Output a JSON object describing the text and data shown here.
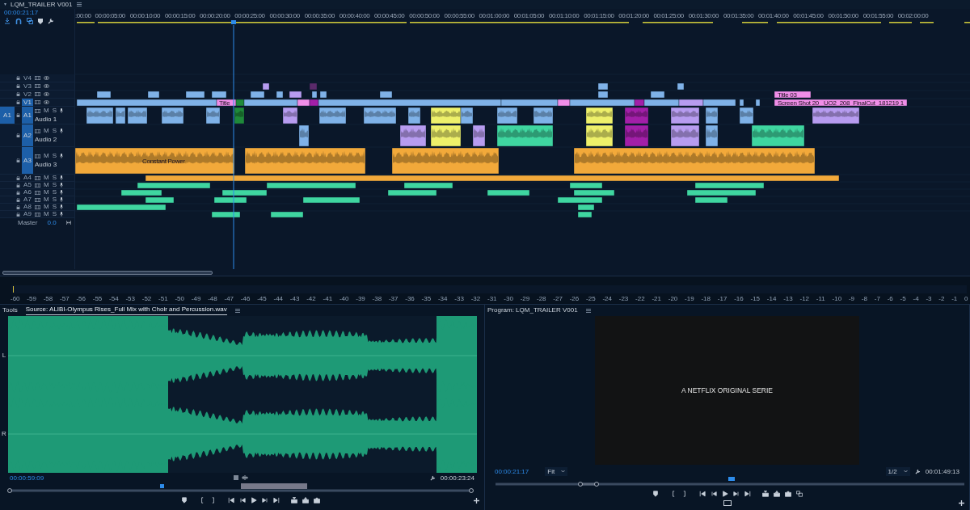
{
  "sequence_tab": {
    "title": "LQM_TRAILER V001"
  },
  "timeline": {
    "timecode": "00:00:21:17",
    "ruler": [
      ":00:00",
      "00:00:05:00",
      "00:00:10:00",
      "00:00:15:00",
      "00:00:20:00",
      "00:00:25:00",
      "00:00:30:00",
      "00:00:35:00",
      "00:00:40:00",
      "00:00:45:00",
      "00:00:50:00",
      "00:00:55:00",
      "00:01:00:00",
      "00:01:05:00",
      "00:01:10:00",
      "00:01:15:00",
      "00:01:20:00",
      "00:01:25:00",
      "00:01:30:00",
      "00:01:35:00",
      "00:01:40:00",
      "00:01:45:00",
      "00:01:50:00",
      "00:01:55:00",
      "00:02:00:00"
    ]
  },
  "tracks": [
    {
      "name": "V4",
      "kind": "video",
      "targeted": false
    },
    {
      "name": "V3",
      "kind": "video",
      "targeted": false
    },
    {
      "name": "V2",
      "kind": "video",
      "targeted": false
    },
    {
      "name": "V1",
      "kind": "video",
      "targeted": true
    },
    {
      "name": "A1",
      "kind": "audio",
      "targeted": true,
      "source_patch": "A1",
      "label": "Audio 1",
      "mute": "M",
      "solo": "S"
    },
    {
      "name": "A2",
      "kind": "audio",
      "targeted": true,
      "label": "Audio 2",
      "mute": "M",
      "solo": "S"
    },
    {
      "name": "A3",
      "kind": "audio",
      "targeted": true,
      "label": "Audio 3",
      "mute": "M",
      "solo": "S"
    },
    {
      "name": "A4",
      "kind": "audio",
      "targeted": false,
      "mute": "M",
      "solo": "S"
    },
    {
      "name": "A5",
      "kind": "audio",
      "targeted": false,
      "mute": "M",
      "solo": "S"
    },
    {
      "name": "A6",
      "kind": "audio",
      "targeted": false,
      "mute": "M",
      "solo": "S"
    },
    {
      "name": "A7",
      "kind": "audio",
      "targeted": false,
      "mute": "M",
      "solo": "S"
    },
    {
      "name": "A8",
      "kind": "audio",
      "targeted": false,
      "mute": "M",
      "solo": "S"
    },
    {
      "name": "A9",
      "kind": "audio",
      "targeted": false,
      "mute": "M",
      "solo": "S"
    }
  ],
  "master": {
    "label": "Master",
    "value": "0.0"
  },
  "clip_labels": [
    {
      "text": "Title"
    },
    {
      "text": "Constant Power"
    },
    {
      "text": "Title 03"
    },
    {
      "text": "Screen Shot 20"
    },
    {
      "text": "UO2_208_FinalCut_181219 1"
    }
  ],
  "meter": {
    "scale": [
      "-60",
      "-59",
      "-58",
      "-57",
      "-56",
      "-55",
      "-54",
      "-53",
      "-52",
      "-51",
      "-50",
      "-49",
      "-48",
      "-47",
      "-46",
      "-45",
      "-44",
      "-43",
      "-42",
      "-41",
      "-40",
      "-39",
      "-38",
      "-37",
      "-36",
      "-35",
      "-34",
      "-33",
      "-32",
      "-31",
      "-30",
      "-29",
      "-28",
      "-27",
      "-26",
      "-25",
      "-24",
      "-23",
      "-22",
      "-21",
      "-20",
      "-19",
      "-18",
      "-17",
      "-16",
      "-15",
      "-14",
      "-13",
      "-12",
      "-11",
      "-10",
      "-9",
      "-8",
      "-7",
      "-6",
      "-5",
      "-4",
      "-3",
      "-2",
      "-1",
      "0"
    ]
  },
  "source": {
    "tabs": [
      {
        "label": "Tools",
        "selected": false
      },
      {
        "label": "Source: ALIBI-Olympus Rises_Full Mix with Choir and Percussion.wav",
        "selected": true
      }
    ],
    "channels": [
      "L",
      "R"
    ],
    "timecode": "00:00:59:09",
    "duration": "00:00:23:24"
  },
  "program": {
    "tabs": [
      {
        "label": "Program: LQM_TRAILER V001",
        "selected": false
      }
    ],
    "frame_text": "A NETFLIX ORIGINAL SERIE",
    "timecode": "00:00:21:17",
    "fit": "Fit",
    "resolution": "1/2",
    "duration": "00:01:49:13"
  }
}
